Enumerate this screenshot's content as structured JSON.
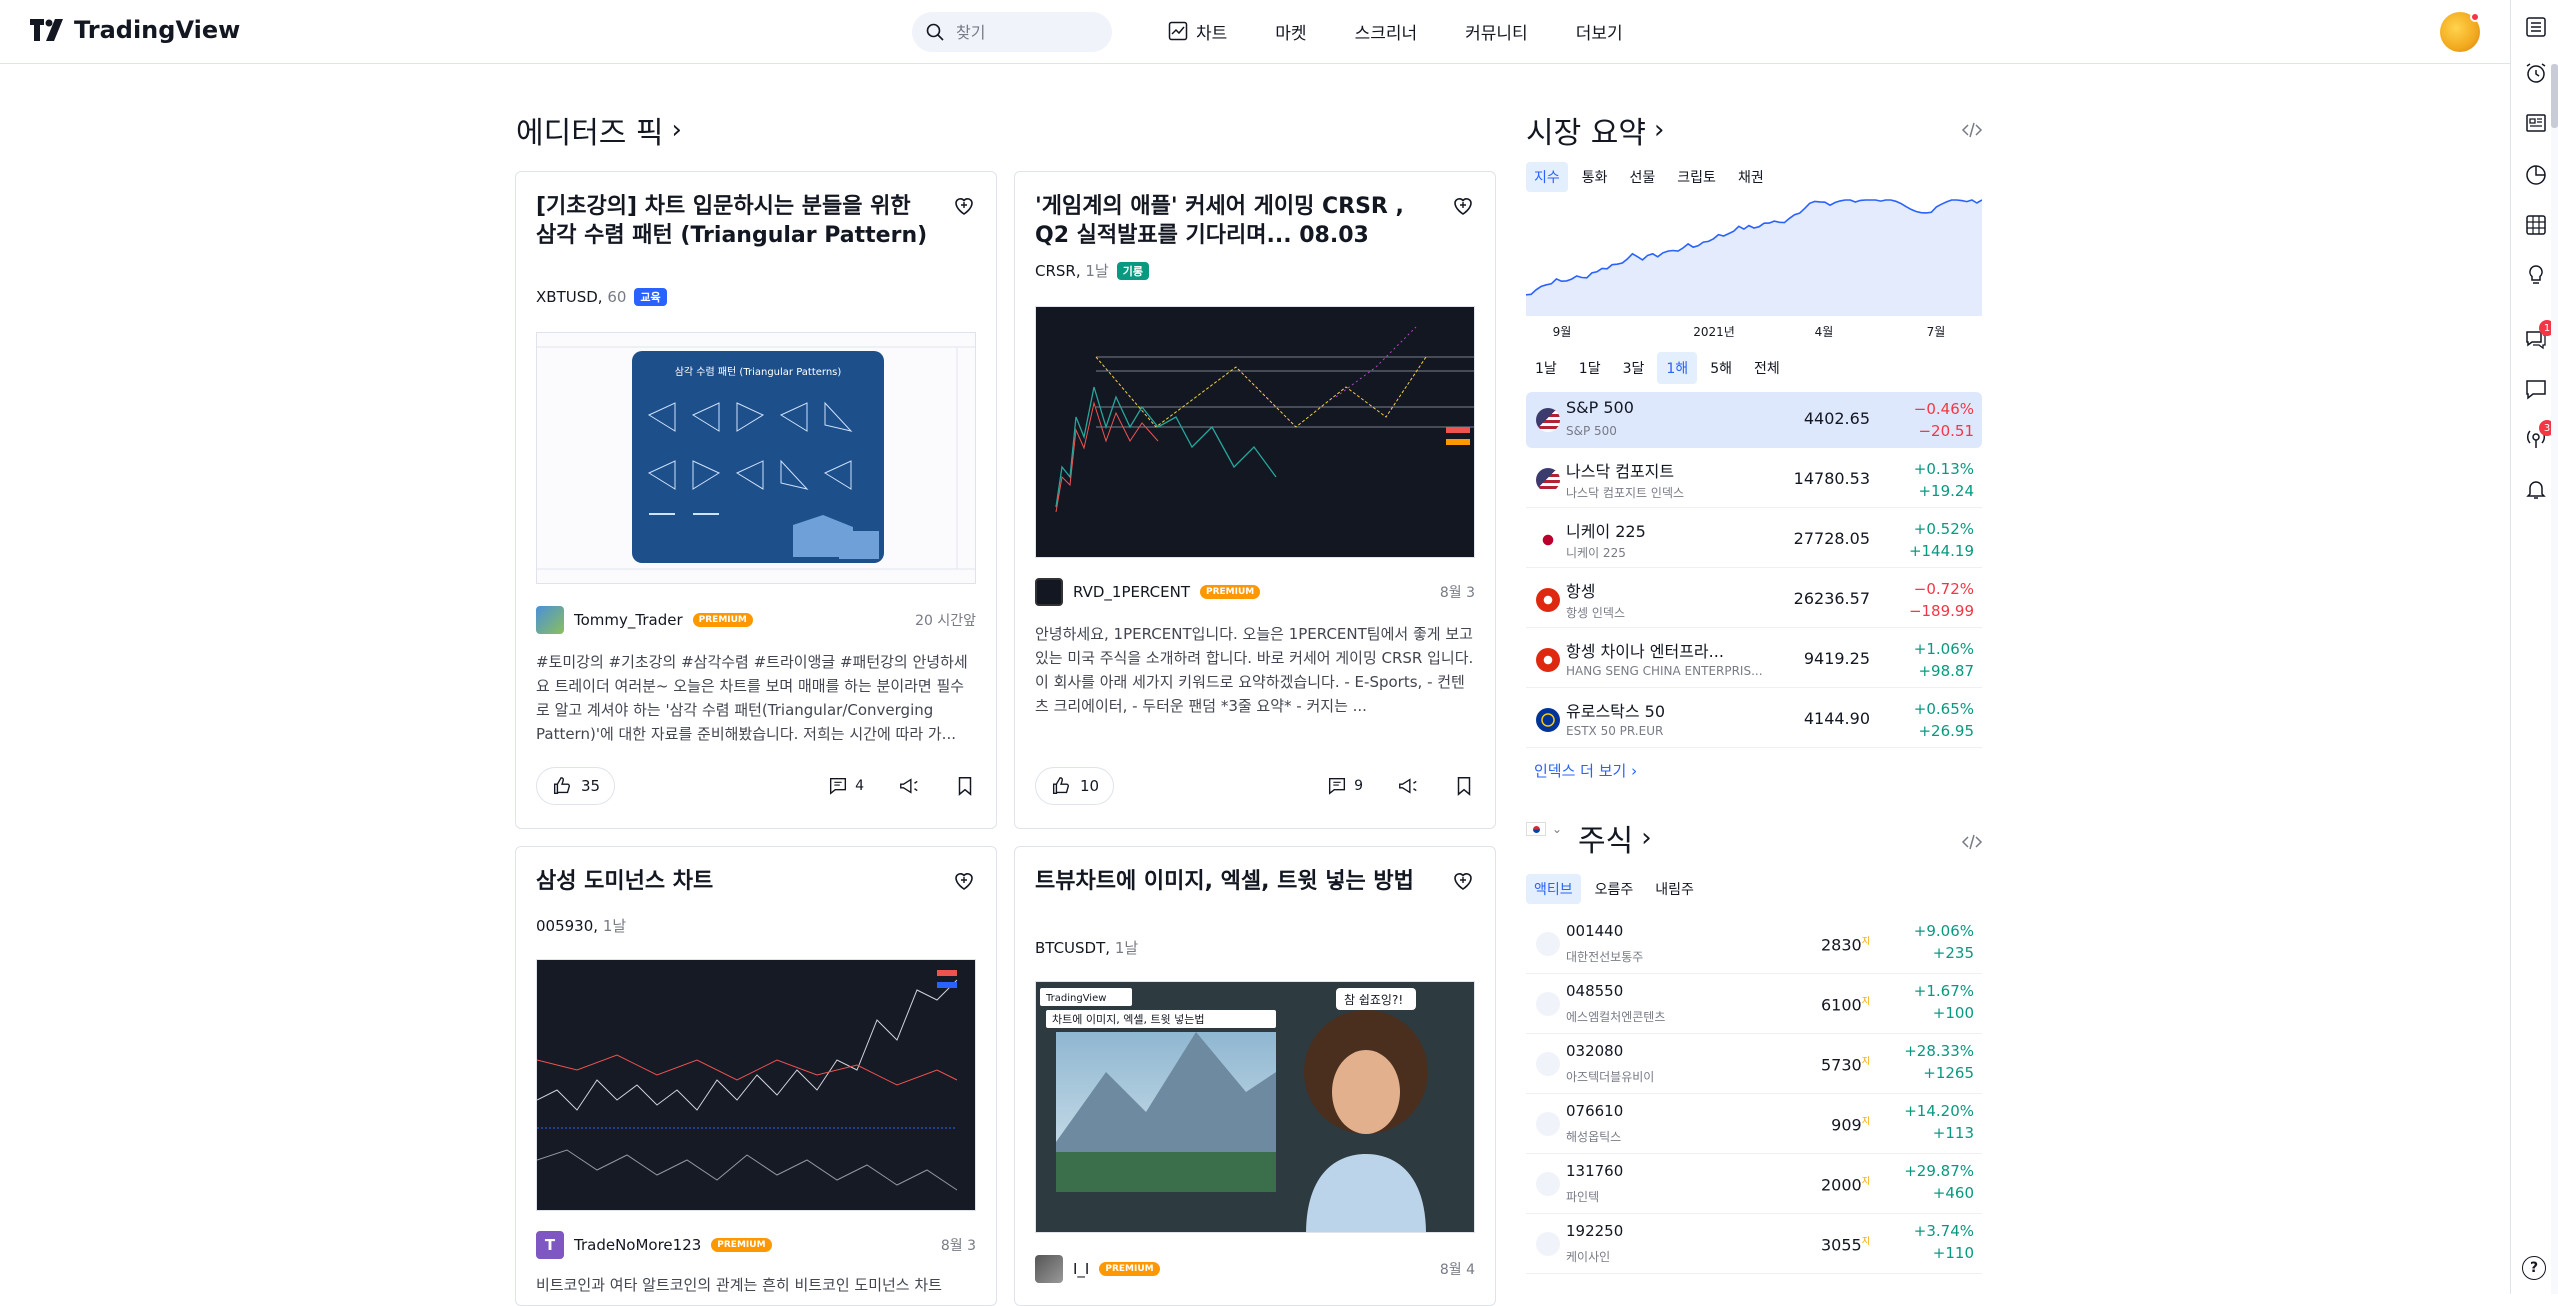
{
  "header": {
    "brand": "TradingView",
    "search_placeholder": "찾기",
    "nav": [
      "차트",
      "마켓",
      "스크리너",
      "커뮤니티",
      "더보기"
    ]
  },
  "rail": {
    "alerts_badge": "1",
    "streams_badge": "3"
  },
  "editors_picks": {
    "title": "에디터즈 픽",
    "cards": [
      {
        "title": "[기초강의] 차트 입문하시는 분들을 위한 삼각 수렴 패턴 (Triangular Pattern)",
        "symbol": "XBTUSD",
        "interval": "60",
        "tag": "교육",
        "tag_color": "#2962ff",
        "author": "Tommy_Trader",
        "premium": "PREMIUM",
        "time": "20 시간앞",
        "desc": "#토미강의 #기초강의 #삼각수렴 #트라이앵글 #패턴강의 안녕하세요 트레이더 여러분~ 오늘은 차트를 보며 매매를 하는 분이라면 필수로 알고 계셔야 하는 '삼각 수렴 패턴(Triangular/Converging Pattern)'에 대한 자료를 준비해봤습니다. 저희는 시간에 따라 가...",
        "likes": "35",
        "comments": "4"
      },
      {
        "title": "'게임계의 애플' 커세어 게이밍 CRSR , Q2 실적발표를 기다리며... 08.03",
        "symbol": "CRSR",
        "interval": "1날",
        "tag": "기롱",
        "tag_color": "#089981",
        "author": "RVD_1PERCENT",
        "premium": "PREMIUM",
        "time": "8월 3",
        "desc": "안녕하세요, 1PERCENT입니다. 오늘은 1PERCENT팀에서 좋게 보고 있는 미국 주식을 소개하려 합니다. 바로 커세어 게이밍 CRSR 입니다. 이 회사를 아래 세가지 키워드로 요약하겠습니다. - E-Sports, - 컨텐츠 크리에이터, - 두터운 팬덤 *3줄 요약* - 커지는 ...",
        "likes": "10",
        "comments": "9"
      },
      {
        "title": "삼성 도미넌스 차트",
        "symbol": "005930",
        "interval": "1날",
        "author": "TradeNoMore123",
        "premium": "PREMIUM",
        "time": "8월 3",
        "desc": "비트코인과 여타 알트코인의 관계는 흔히 비트코인 도미넌스 차트"
      },
      {
        "title": "트뷰차트에 이미지, 엑셀, 트윗 넣는 방법",
        "symbol": "BTCUSDT",
        "interval": "1날",
        "author": "I_I",
        "premium": "PREMIUM",
        "time": "8월 4",
        "thumb_brand": "TradingView",
        "thumb_bubble": "참 쉽죠잉?!",
        "thumb_caption": "차트에 이미지, 엑셀, 트윗 넣는법"
      }
    ],
    "thumb1": {
      "heading": "삼각 수렴 패턴 (Triangular Patterns)"
    }
  },
  "market_summary": {
    "title": "시장 요약",
    "tabs": [
      "지수",
      "통화",
      "선물",
      "크립토",
      "채권"
    ],
    "active_tab": 0,
    "chart_labels": [
      "9월",
      "2021년",
      "4월",
      "7월"
    ],
    "periods": [
      "1날",
      "1달",
      "3달",
      "1해",
      "5해",
      "전체"
    ],
    "active_period": 3,
    "rows": [
      {
        "name": "S&P 500",
        "sub": "S&P 500",
        "value": "4402.65",
        "pct": "−0.46%",
        "chg": "−20.51",
        "dir": "dn",
        "flag": "us"
      },
      {
        "name": "나스닥 컴포지트",
        "sub": "나스닥 컴포지트 인덱스",
        "value": "14780.53",
        "pct": "+0.13%",
        "chg": "+19.24",
        "dir": "up",
        "flag": "us"
      },
      {
        "name": "니케이 225",
        "sub": "니케이 225",
        "value": "27728.05",
        "pct": "+0.52%",
        "chg": "+144.19",
        "dir": "up",
        "flag": "jp"
      },
      {
        "name": "항셍",
        "sub": "항셍 인덱스",
        "value": "26236.57",
        "pct": "−0.72%",
        "chg": "−189.99",
        "dir": "dn",
        "flag": "hk"
      },
      {
        "name": "항셍 차이나 엔터프라...",
        "sub": "HANG SENG CHINA ENTERPRIS...",
        "value": "9419.25",
        "pct": "+1.06%",
        "chg": "+98.87",
        "dir": "up",
        "flag": "hk"
      },
      {
        "name": "유로스탁스 50",
        "sub": "ESTX 50 PR.EUR",
        "value": "4144.90",
        "pct": "+0.65%",
        "chg": "+26.95",
        "dir": "up",
        "flag": "eu"
      }
    ],
    "more": "인덱스 더 보기 ›"
  },
  "stocks": {
    "title": "주식",
    "tabs": [
      "액티브",
      "오름주",
      "내림주"
    ],
    "active_tab": 0,
    "rows": [
      {
        "code": "001440",
        "name": "대한전선보통주",
        "value": "2830",
        "pct": "+9.06%",
        "chg": "+235"
      },
      {
        "code": "048550",
        "name": "에스엠컬처엔콘텐츠",
        "value": "6100",
        "pct": "+1.67%",
        "chg": "+100"
      },
      {
        "code": "032080",
        "name": "아즈텍더블유비이",
        "value": "5730",
        "pct": "+28.33%",
        "chg": "+1265"
      },
      {
        "code": "076610",
        "name": "해성옵틱스",
        "value": "909",
        "pct": "+14.20%",
        "chg": "+113"
      },
      {
        "code": "131760",
        "name": "파인텍",
        "value": "2000",
        "pct": "+29.87%",
        "chg": "+460"
      },
      {
        "code": "192250",
        "name": "케이사인",
        "value": "3055",
        "pct": "+3.74%",
        "chg": "+110"
      }
    ],
    "currency_mark": "지"
  },
  "colors": {
    "accent": "#2962ff",
    "up": "#089981",
    "down": "#f23645",
    "premium": "#ff9800"
  }
}
